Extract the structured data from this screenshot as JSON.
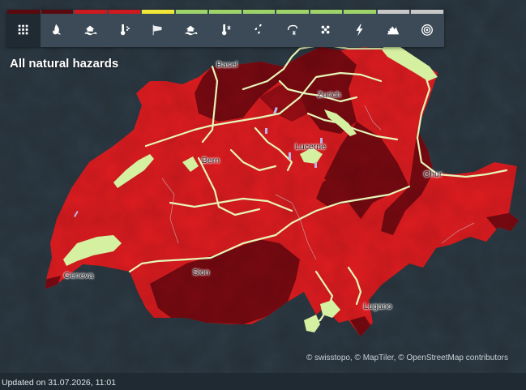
{
  "title": "All natural hazards",
  "toolbar": [
    {
      "icon": "grid-icon",
      "color": "#5a0a0f",
      "name": "all-hazards"
    },
    {
      "icon": "wildfire-icon",
      "color": "#5a0a0f",
      "name": "forest-fire"
    },
    {
      "icon": "flood-icon",
      "color": "#cc1a1f",
      "name": "flood"
    },
    {
      "icon": "heat-icon",
      "color": "#cc1a1f",
      "name": "heat"
    },
    {
      "icon": "wind-icon",
      "color": "#f0e63a",
      "name": "wind"
    },
    {
      "icon": "lake-icon",
      "color": "#9ed36a",
      "name": "lake-level"
    },
    {
      "icon": "frost-icon",
      "color": "#9ed36a",
      "name": "frost"
    },
    {
      "icon": "rain-icon",
      "color": "#9ed36a",
      "name": "rain"
    },
    {
      "icon": "snowfall-icon",
      "color": "#9ed36a",
      "name": "snowfall"
    },
    {
      "icon": "slippery-roads-icon",
      "color": "#9ed36a",
      "name": "slippery-roads"
    },
    {
      "icon": "thunderstorm-icon",
      "color": "#9ed36a",
      "name": "thunderstorm"
    },
    {
      "icon": "avalanche-icon",
      "color": "#c8c8c8",
      "name": "avalanche"
    },
    {
      "icon": "earthquake-icon",
      "color": "#c8c8c8",
      "name": "earthquake"
    }
  ],
  "cities": {
    "basel": "Basel",
    "zurich": "Zurich",
    "bern": "Bern",
    "lucerne": "Lucerne",
    "chur": "Chur",
    "geneva": "Geneva",
    "sion": "Sion",
    "lugano": "Lugano"
  },
  "colors": {
    "water": "#2c3a44",
    "level_red": "#e21e22",
    "level_dark": "#7a0a12",
    "lake": "#d8f0a0",
    "river": "#d8f0a0"
  },
  "attribution": "© swisstopo, © MapTiler, © OpenStreetMap contributors",
  "footer": "Updated on 31.07.2026, 11:01"
}
